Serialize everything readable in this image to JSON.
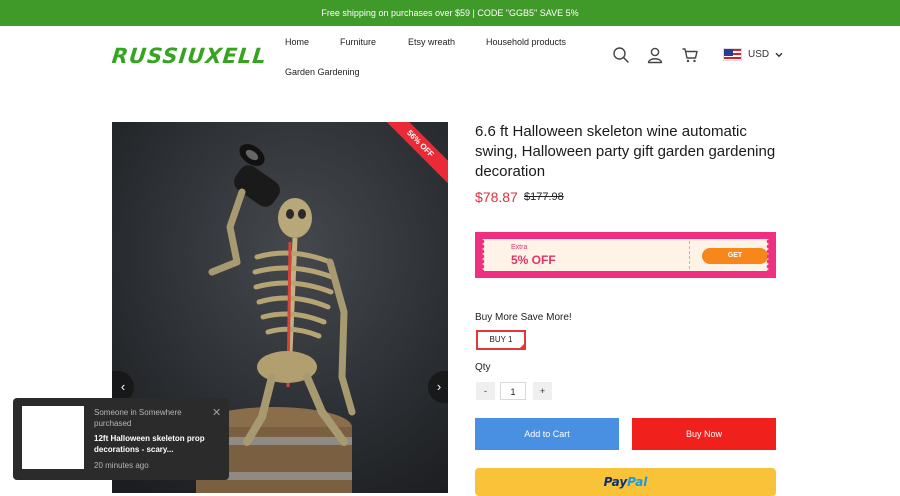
{
  "announcement": "Free shipping on purchases over $59 | CODE \"GGB5\" SAVE 5%",
  "brand": {
    "logo": "RUSSIUXELL",
    "color": "#37a421"
  },
  "nav": [
    "Home",
    "Furniture",
    "Etsy wreath",
    "Household products",
    "Garden Gardening"
  ],
  "header": {
    "currency": "USD",
    "icons": [
      "search-icon",
      "user-icon",
      "cart-icon",
      "us-flag-icon",
      "chevron-down-icon"
    ]
  },
  "gallery": {
    "discount_badge": "56% OFF",
    "prev_symbol": "‹",
    "next_symbol": "›"
  },
  "product": {
    "title": "6.6 ft Halloween skeleton wine automatic swing, Halloween party gift garden gardening decoration",
    "price": "$78.87",
    "compare_price": "$177.98"
  },
  "coupon": {
    "extra": "Extra",
    "discount": "5% OFF",
    "button": "GET"
  },
  "bundle": {
    "label": "Buy More Save More!",
    "option": "BUY 1"
  },
  "quantity": {
    "label": "Qty",
    "minus": "-",
    "value": "1",
    "plus": "+"
  },
  "actions": {
    "add_to_cart": "Add to Cart",
    "buy_now": "Buy Now"
  },
  "paypal": {
    "part1": "Pay",
    "part2": "Pal"
  },
  "purchase_popup": {
    "line1": "Someone in Somewhere",
    "line2": "purchased",
    "product": "12ft Halloween skeleton prop decorations - scary...",
    "time": "20 minutes ago",
    "close_symbol": "✕"
  },
  "colors": {
    "announcement_bg": "#3f9a29",
    "accent_red": "#e02f3e",
    "add_to_cart": "#4a90e2",
    "buy_now": "#f0201d",
    "paypal": "#f8c339",
    "coupon_border": "#ef2f80"
  }
}
